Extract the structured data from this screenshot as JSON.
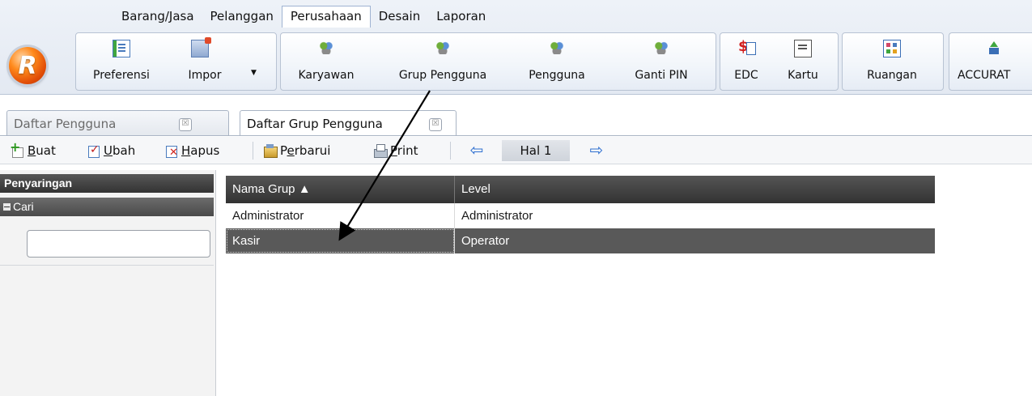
{
  "menu_tabs": [
    "Barang/Jasa",
    "Pelanggan",
    "Perusahaan",
    "Desain",
    "Laporan"
  ],
  "active_menu_tab": "Perusahaan",
  "app_logo_letter": "R",
  "ribbon": {
    "preferensi": "Preferensi",
    "impor": "Impor",
    "karyawan": "Karyawan",
    "grup_pengguna": "Grup Pengguna",
    "pengguna": "Pengguna",
    "ganti_pin": "Ganti PIN",
    "edc": "EDC",
    "kartu": "Kartu",
    "ruangan": "Ruangan",
    "accurate": "ACCURAT"
  },
  "doc_tabs": {
    "tab1": "Daftar Pengguna",
    "tab2": "Daftar Grup Pengguna",
    "close_glyph": "☒"
  },
  "toolbar": {
    "buat_key": "B",
    "buat_rest": "uat",
    "ubah_key": "U",
    "ubah_rest": "bah",
    "hapus_key": "H",
    "hapus_rest": "apus",
    "perbarui_pre": "P",
    "perbarui_key": "e",
    "perbarui_rest": "rbarui",
    "print_key": "P",
    "print_rest": "rint",
    "page_label": "Hal 1",
    "prev_glyph": "⇦",
    "next_glyph": "⇨"
  },
  "filter": {
    "title": "Penyaringan",
    "section": "Cari",
    "search_value": ""
  },
  "grid": {
    "columns": [
      "Nama Grup ▲",
      "Level"
    ],
    "rows": [
      {
        "nama": "Administrator",
        "level": "Administrator"
      },
      {
        "nama": "Kasir",
        "level": "Operator"
      }
    ],
    "selected_row": 1
  },
  "colors": {
    "ribbon_bg": "#e3e9f2",
    "orb": "#ff8a1c",
    "header_dark": "#333333",
    "selected_row": "#595959"
  }
}
